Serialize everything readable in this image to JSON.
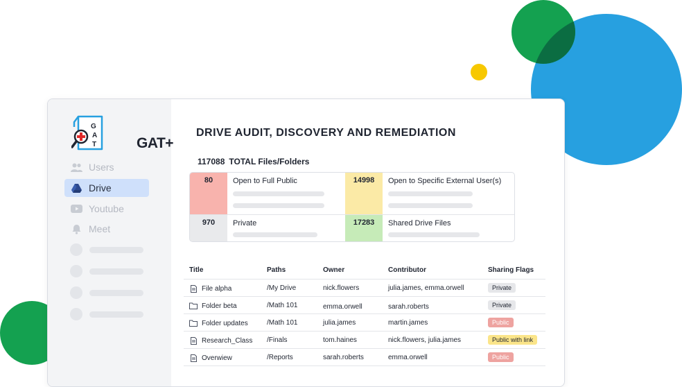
{
  "app": {
    "logo_letters": "GAT",
    "logo_text": "GAT+"
  },
  "sidebar": {
    "items": [
      {
        "label": "Users",
        "icon": "users-icon",
        "active": false
      },
      {
        "label": "Drive",
        "icon": "drive-icon",
        "active": true
      },
      {
        "label": "Youtube",
        "icon": "youtube-icon",
        "active": false
      },
      {
        "label": "Meet",
        "icon": "meet-icon",
        "active": false
      }
    ]
  },
  "main": {
    "title": "DRIVE AUDIT, DISCOVERY AND REMEDIATION",
    "total_count": "117088",
    "total_label": "TOTAL Files/Folders"
  },
  "stats": [
    {
      "value": "80",
      "label": "Open to Full Public",
      "color": "#f8b3ad"
    },
    {
      "value": "14998",
      "label": "Open to Specific External User(s)",
      "color": "#fbeaa6"
    },
    {
      "value": "970",
      "label": "Private",
      "color": "#e9eaec"
    },
    {
      "value": "17283",
      "label": "Shared Drive Files",
      "color": "#c6ebb8"
    }
  ],
  "table": {
    "headers": [
      "Title",
      "Paths",
      "Owner",
      "Contributor",
      "Sharing Flags"
    ],
    "rows": [
      {
        "title": "File alpha",
        "icon": "file-icon",
        "path": "/My Drive",
        "owner": "nick.flowers",
        "contributor": "julia.james, emma.orwell",
        "flag": "Private"
      },
      {
        "title": "Folder beta",
        "icon": "folder-icon",
        "path": "/Math 101",
        "owner": "emma.orwell",
        "contributor": "sarah.roberts",
        "flag": "Private"
      },
      {
        "title": "Folder updates",
        "icon": "folder-icon",
        "path": "/Math 101",
        "owner": "julia.james",
        "contributor": "martin.james",
        "flag": "Public"
      },
      {
        "title": "Research_Class",
        "icon": "file-icon",
        "path": "/Finals",
        "owner": "tom.haines",
        "contributor": "nick.flowers, julia.james",
        "flag": "Public with link"
      },
      {
        "title": "Overwiew",
        "icon": "file-icon",
        "path": "/Reports",
        "owner": "sarah.roberts",
        "contributor": "emma.orwell",
        "flag": "Public"
      }
    ]
  },
  "colors": {
    "flag_private_bg": "#e6e7ea",
    "flag_public_bg": "#eea3a0",
    "flag_public_link_bg": "#fbe58a",
    "accent_blue": "#27a0e0",
    "accent_green": "#14a150",
    "accent_yellow": "#f7c800"
  }
}
